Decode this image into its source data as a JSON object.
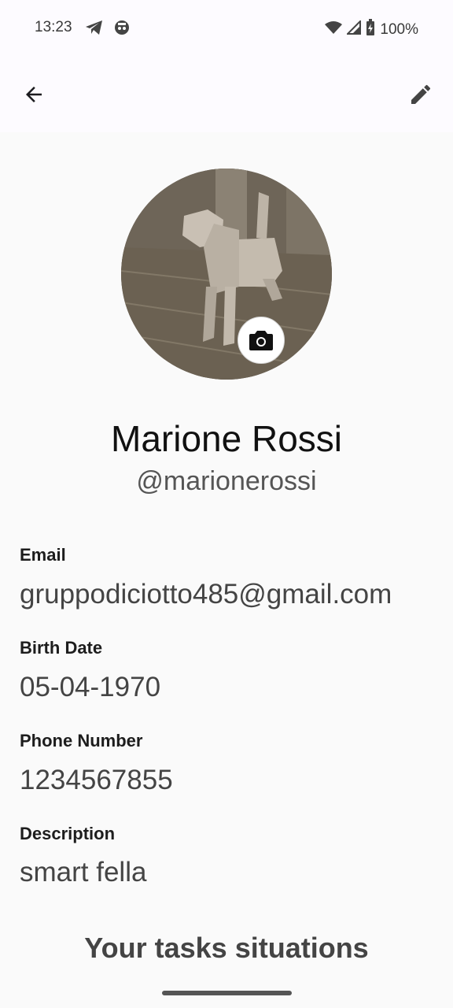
{
  "status_bar": {
    "time": "13:23",
    "battery": "100%",
    "icons": [
      "telegram-icon",
      "robot-notification-icon",
      "wifi-icon",
      "signal-icon",
      "battery-charging-icon"
    ]
  },
  "app_bar": {
    "back_icon": "arrow-back-icon",
    "edit_icon": "edit-pencil-icon"
  },
  "profile": {
    "avatar_icon": "camera-icon",
    "name": "Marione Rossi",
    "handle": "@marionerossi"
  },
  "fields": {
    "email": {
      "label": "Email",
      "value": "gruppodiciotto485@gmail.com"
    },
    "birth_date": {
      "label": "Birth Date",
      "value": "05-04-1970"
    },
    "phone": {
      "label": "Phone Number",
      "value": "1234567855"
    },
    "description": {
      "label": "Description",
      "value": "smart fella"
    }
  },
  "tasks": {
    "heading": "Your tasks situations"
  }
}
